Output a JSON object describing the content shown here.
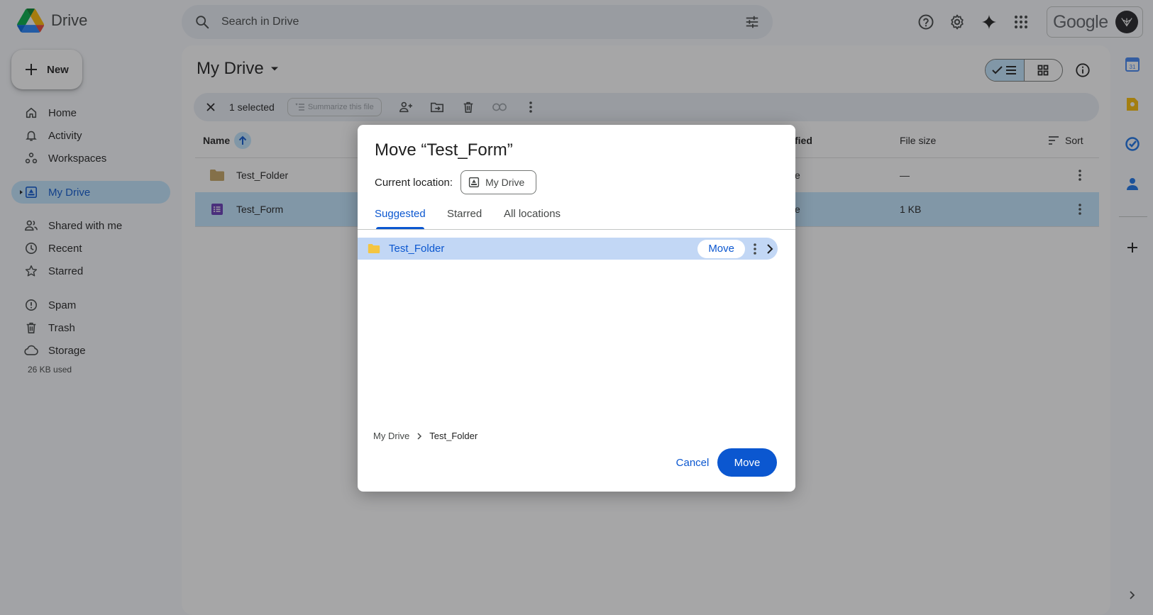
{
  "app": {
    "name": "Drive"
  },
  "search": {
    "placeholder": "Search in Drive"
  },
  "header": {
    "google_label": "Google"
  },
  "sidebar": {
    "new_label": "New",
    "items": [
      {
        "label": "Home",
        "icon": "home-icon"
      },
      {
        "label": "Activity",
        "icon": "bell-icon"
      },
      {
        "label": "Workspaces",
        "icon": "workspaces-icon"
      },
      {
        "label": "My Drive",
        "icon": "drive-icon",
        "active": true
      },
      {
        "label": "Shared with me",
        "icon": "people-icon"
      },
      {
        "label": "Recent",
        "icon": "clock-icon"
      },
      {
        "label": "Starred",
        "icon": "star-icon"
      },
      {
        "label": "Spam",
        "icon": "spam-icon"
      },
      {
        "label": "Trash",
        "icon": "trash-icon"
      },
      {
        "label": "Storage",
        "icon": "cloud-icon"
      }
    ],
    "storage_used": "26 KB used"
  },
  "main": {
    "title": "My Drive",
    "selection": {
      "count_label": "1 selected",
      "summarize_label": "Summarize this file"
    },
    "columns": {
      "name": "Name",
      "modified": "fied",
      "file_size": "File size",
      "sort": "Sort"
    },
    "rows": [
      {
        "name": "Test_Folder",
        "modified": "e",
        "size": "—",
        "type": "folder"
      },
      {
        "name": "Test_Form",
        "modified": "e",
        "size": "1 KB",
        "type": "form",
        "selected": true
      }
    ]
  },
  "dialog": {
    "title": "Move “Test_Form”",
    "current_location_label": "Current location:",
    "current_location_value": "My Drive",
    "tabs": [
      "Suggested",
      "Starred",
      "All locations"
    ],
    "active_tab": "Suggested",
    "locations": [
      {
        "name": "Test_Folder",
        "move_label": "Move"
      }
    ],
    "breadcrumb": [
      "My Drive",
      "Test_Folder"
    ],
    "cancel_label": "Cancel",
    "move_label": "Move"
  },
  "colors": {
    "accent": "#0b57d0",
    "selected_bg": "#c2e7ff",
    "form_purple": "#673ab7",
    "folder_yellow": "#f4b400"
  }
}
